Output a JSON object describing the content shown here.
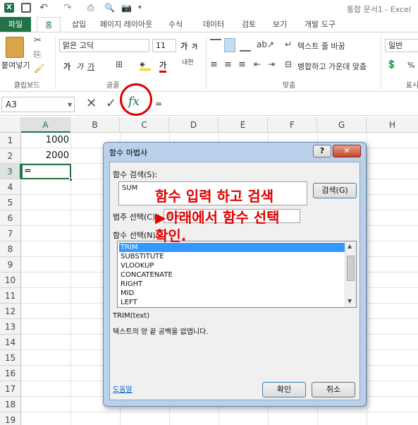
{
  "window": {
    "title": "통합 문서1 - Excel"
  },
  "tabs": [
    "파일",
    "홈",
    "삽입",
    "페이지 레이아웃",
    "수식",
    "데이터",
    "검토",
    "보기",
    "개발 도구"
  ],
  "ribbon": {
    "paste_label": "붙여넣기",
    "font_name": "맑은 고딕",
    "font_size": "11",
    "wrap_text": "텍스트 줄 바꿈",
    "merge_center": "병합하고 가운데 맞춤",
    "number_format": "일반",
    "groups": {
      "clipboard": "클립보드",
      "font": "글꼴",
      "alignment": "맞춤",
      "number": "표시"
    },
    "font_grow": "가",
    "font_shrink": "가",
    "bold": "가",
    "italic": "가",
    "underline": "가",
    "font_color": "가",
    "phonetic": "내천",
    "percent": "%"
  },
  "formula_bar": {
    "name_box": "A3",
    "fx": "fx",
    "content": "="
  },
  "columns": [
    "A",
    "B",
    "C",
    "D",
    "E",
    "F",
    "G",
    "H"
  ],
  "rows": [
    "1",
    "2",
    "3",
    "4",
    "5",
    "6",
    "7",
    "8",
    "9",
    "10",
    "11",
    "12",
    "13",
    "14",
    "15",
    "16",
    "17",
    "18",
    "19"
  ],
  "cells": {
    "A1": "1000",
    "A2": "2000",
    "A3": "="
  },
  "dialog": {
    "title": "함수 마법사",
    "help_btn": "?",
    "close_btn": "✕",
    "search_label": "함수 검색(S):",
    "search_value": "SUM",
    "search_button": "검색(G)",
    "category_label": "범주 선택(C):",
    "category_value": "최근",
    "function_label": "함수 선택(N):",
    "functions": [
      "TRIM",
      "SUBSTITUTE",
      "VLOOKUP",
      "CONCATENATE",
      "RIGHT",
      "MID",
      "LEFT"
    ],
    "selected_function": "TRIM",
    "signature": "TRIM(text)",
    "description": "텍스트의 양 끝 공백을 없앱니다.",
    "help_link": "도움말",
    "ok": "확인",
    "cancel": "취소"
  },
  "annotation": {
    "line1": "함수 입력 하고 검색",
    "line2": "▶아래에서 함수 선택",
    "line3": "확인."
  },
  "colors": {
    "excel_green": "#217346",
    "annotation_red": "#e00000",
    "selection_blue": "#3399ff"
  }
}
